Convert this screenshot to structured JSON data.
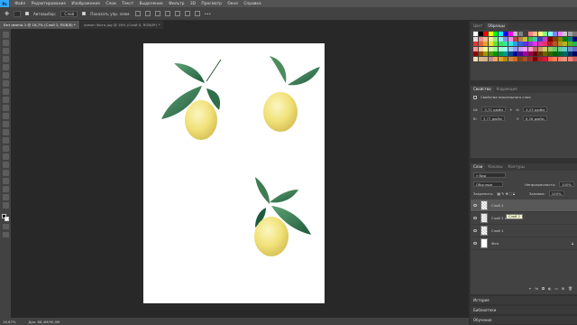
{
  "menubar": {
    "logo": "Ps",
    "items": [
      "Файл",
      "Редактирование",
      "Изображение",
      "Слои",
      "Текст",
      "Выделение",
      "Фильтр",
      "3D",
      "Просмотр",
      "Окно",
      "Справка"
    ]
  },
  "options": {
    "autoselect_label": "Автовыбор:",
    "layer_select": "Слой",
    "transform_label": "Показать упр. элем."
  },
  "tabs": [
    {
      "label": "Без имени-1 @ 16,7% (Слой 2, RGB/8) *",
      "active": true
    },
    {
      "label": "лимон Фото.jpg @ 16% (Слой 0, RGB/8*) *",
      "active": false
    }
  ],
  "status": {
    "zoom": "16,67%",
    "doc": "Док: 68,4М/95,0М"
  },
  "colors": {
    "accent": "#31a8ff",
    "canvas_bg": "#282828",
    "panel_bg": "#424242"
  },
  "swatch_panel": {
    "tabs": [
      "Цвет",
      "Образцы"
    ],
    "colors": [
      "#ffffff",
      "#000000",
      "#ff0000",
      "#ffff00",
      "#00ff00",
      "#00ffff",
      "#0000ff",
      "#ff00ff",
      "#bfbfbf",
      "#808080",
      "#404040",
      "#ff8080",
      "#ffbf80",
      "#ffff80",
      "#80ff80",
      "#80ffff",
      "#8080ff",
      "#ff80ff",
      "#c8c8c8",
      "#a0a0a0",
      "#787878",
      "#e0e0e0",
      "#f08c8c",
      "#f0c08c",
      "#f0f08c",
      "#8cf08c",
      "#8cf0f0",
      "#8c8cf0",
      "#f08cf0",
      "#c04040",
      "#c08040",
      "#c0c040",
      "#40c040",
      "#40c0c0",
      "#4040c0",
      "#c040c0",
      "#800000",
      "#804000",
      "#808000",
      "#008000",
      "#008080",
      "#000080",
      "#e63232",
      "#e66432",
      "#e6a032",
      "#e6e632",
      "#64e632",
      "#32e664",
      "#32e6a0",
      "#32e6e6",
      "#32a0e6",
      "#3264e6",
      "#6432e6",
      "#a032e6",
      "#e632e6",
      "#e632a0",
      "#e63264",
      "#b41e1e",
      "#b45a1e",
      "#b4961e",
      "#b4b41e",
      "#5ab41e",
      "#1eb45a",
      "#ff9999",
      "#ffcc99",
      "#ffff99",
      "#ccff99",
      "#99ff99",
      "#99ffcc",
      "#99ffff",
      "#99ccff",
      "#9999ff",
      "#cc99ff",
      "#ff99ff",
      "#ff99cc",
      "#cc6666",
      "#cc9966",
      "#cccc66",
      "#99cc66",
      "#66cc66",
      "#66cc99",
      "#66cccc",
      "#6699cc",
      "#6666cc",
      "#990000",
      "#994c00",
      "#999900",
      "#4c9900",
      "#009900",
      "#00994c",
      "#009999",
      "#004c99",
      "#000099",
      "#4c0099",
      "#990099",
      "#99004c",
      "#660000",
      "#663300",
      "#666600",
      "#336600",
      "#006600",
      "#006633",
      "#006666",
      "#003366",
      "#000066",
      "#f5deb3",
      "#deb887",
      "#d2b48c",
      "#bc8f8f",
      "#f4a460",
      "#daa520",
      "#b8860b",
      "#cd853f",
      "#d2691e",
      "#8b4513",
      "#a0522d",
      "#a52a2a",
      "#800000",
      "#b22222",
      "#dc143c",
      "#ff6347",
      "#ff7f50",
      "#fa8072",
      "#e9967a",
      "#f08080",
      "#cd5c5c"
    ]
  },
  "properties_panel": {
    "tabs": [
      "Свойства",
      "Коррекция"
    ],
    "subtitle": "Свойства пиксельного слоя",
    "w_label": "Ш:",
    "w_value": "3,72 дюйм",
    "x_label": "X:",
    "x_value": "4,23 дюйм",
    "h_label": "В:",
    "h_value": "3,77 дюйм",
    "y_label": "Y:",
    "y_value": "6,26 дюйм"
  },
  "layers_panel": {
    "tabs": [
      "Слои",
      "Каналы",
      "Контуры"
    ],
    "filter": "Вид",
    "blend": "Обычные",
    "opacity_label": "Непрозрачность:",
    "opacity": "100%",
    "lock_label": "Закрепить:",
    "fill_label": "Заливка:",
    "fill": "100%",
    "layers": [
      {
        "name": "Слой 2",
        "selected": true,
        "white": false
      },
      {
        "name": "Слой 2 копия",
        "selected": false,
        "white": false
      },
      {
        "name": "Слой 1",
        "selected": false,
        "white": false
      },
      {
        "name": "Фон",
        "selected": false,
        "white": true
      }
    ],
    "tooltip": "Слой 2"
  },
  "collapsed_panels": [
    "История",
    "Библиотеки",
    "Обучение"
  ]
}
